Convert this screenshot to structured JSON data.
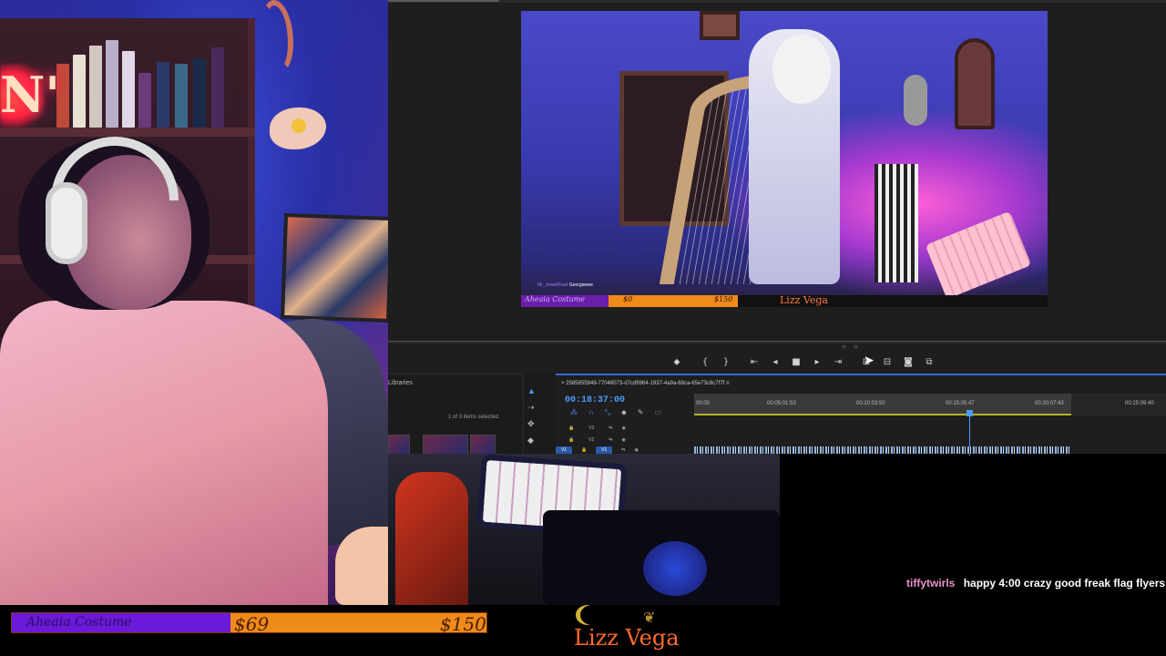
{
  "program_monitor": {
    "overlay_goal_label": "Aheaia Costume",
    "overlay_goal_current": "$0",
    "overlay_goal_target": "$150",
    "overlay_brand": "Lizz Vega",
    "overlay_chat_user": "Mr_JewelRoad",
    "overlay_chat_text": "Georgieeee"
  },
  "transport": {
    "buttons": [
      "marker-icon",
      "mark-in-icon",
      "mark-out-icon",
      "go-to-in-icon",
      "step-back-icon",
      "stop-icon",
      "play-icon",
      "go-to-out-icon",
      "insert-icon",
      "overwrite-icon",
      "export-frame-icon",
      "compare-icon"
    ]
  },
  "libraries": {
    "title": "Libraries",
    "selection_text": "1 of 3 items selected"
  },
  "timeline": {
    "sequence_name": "2585855949-77048073-d7cd9964-1937-4a9a-88ca-65e73c8c7f7f",
    "timecode": "00:18:37:00",
    "ruler_ticks": [
      "00:00",
      "00:05:01:53",
      "00:10:03:50",
      "00:15:05:47",
      "00:20:07:43",
      "00:25:09:40"
    ],
    "tracks": [
      {
        "label": "V3"
      },
      {
        "label": "V2"
      },
      {
        "label": "V1",
        "source": "V1"
      }
    ],
    "playhead_fraction": 0.73
  },
  "chat": {
    "username": "tiffytwirls",
    "message": "happy 4:00 crazy good freak flag flyers"
  },
  "goal": {
    "label": "Aheaia Costume",
    "current": "$69",
    "target": "$150",
    "progress": 0.46
  },
  "brand": {
    "name": "Lizz Vega"
  },
  "colors": {
    "accent_blue": "#4a9cff",
    "goal_orange": "#f08a1a",
    "goal_purple": "#6a1ad8",
    "brand_orange": "#ff6a2a",
    "chat_username": "#e892c8"
  }
}
